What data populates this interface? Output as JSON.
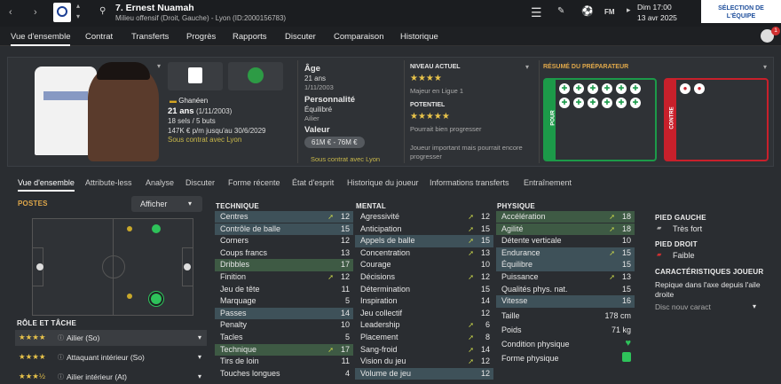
{
  "header": {
    "number_name": "7. Ernest Nuamah",
    "subtitle": "Milieu offensif (Droit, Gauche) - Lyon (ID:2000156783)",
    "day_time": "Dim 17:00",
    "date": "13 avr 2025",
    "team_select": "SÉLECTION DE L'ÉQUIPE",
    "fm_label": "FM",
    "badge_count": "1"
  },
  "nav": [
    "Vue d'ensemble",
    "Contrat",
    "Transferts",
    "Progrès",
    "Rapports",
    "Discuter",
    "Comparaison",
    "Historique"
  ],
  "profile": {
    "nationality": "Ghanéen",
    "age_line": "21 ans",
    "dob": "(1/11/2003)",
    "caps": "18 sels / 5 buts",
    "wage": "147K € p/m jusqu'au 30/6/2029",
    "contract": "Sous contrat avec Lyon"
  },
  "details": {
    "age_label": "Âge",
    "age_value": "21 ans",
    "age_date": "1/11/2003",
    "perso_label": "Personnalité",
    "perso_value": "Équilibré",
    "role_hint": "Ailier",
    "value_label": "Valeur",
    "value": "61M € - 76M €",
    "contract": "Sous contrat avec Lyon"
  },
  "level": {
    "current_label": "NIVEAU ACTUEL",
    "current_stars": "★★★★",
    "current_desc": "Majeur en Ligue 1",
    "potential_label": "POTENTIEL",
    "potential_stars": "★★★★★",
    "potential_desc": "Pourrait bien progresser",
    "summary": "Joueur important mais pourrait encore progresser"
  },
  "coach": {
    "title": "RÉSUMÉ DU PRÉPARATEUR",
    "pour": "POUR",
    "contre": "CONTRE"
  },
  "tabs": [
    "Vue d'ensemble",
    "Attribute-less",
    "Analyse",
    "Discuter",
    "Forme récente",
    "État d'esprit",
    "Historique du joueur",
    "Informations transferts",
    "Entraînement"
  ],
  "positions": {
    "title": "POSTES",
    "display_btn": "Afficher"
  },
  "roles": {
    "title": "RÔLE ET TÂCHE",
    "items": [
      {
        "stars": "★★★★",
        "name": "Ailier (So)"
      },
      {
        "stars": "★★★★",
        "name": "Attaquant intérieur (So)"
      },
      {
        "stars": "★★★½",
        "name": "Ailier intérieur (At)"
      }
    ]
  },
  "technique": {
    "title": "TECHNIQUE",
    "rows": [
      {
        "n": "Centres",
        "v": "12",
        "a": "➚"
      },
      {
        "n": "Contrôle de balle",
        "v": "15",
        "a": ""
      },
      {
        "n": "Corners",
        "v": "12",
        "a": ""
      },
      {
        "n": "Coups francs",
        "v": "13",
        "a": ""
      },
      {
        "n": "Dribbles",
        "v": "17",
        "a": ""
      },
      {
        "n": "Finition",
        "v": "12",
        "a": "➚"
      },
      {
        "n": "Jeu de tête",
        "v": "11",
        "a": ""
      },
      {
        "n": "Marquage",
        "v": "5",
        "a": ""
      },
      {
        "n": "Passes",
        "v": "14",
        "a": ""
      },
      {
        "n": "Penalty",
        "v": "10",
        "a": ""
      },
      {
        "n": "Tacles",
        "v": "5",
        "a": ""
      },
      {
        "n": "Technique",
        "v": "17",
        "a": "➚"
      },
      {
        "n": "Tirs de loin",
        "v": "11",
        "a": ""
      },
      {
        "n": "Touches longues",
        "v": "4",
        "a": ""
      }
    ]
  },
  "mental": {
    "title": "MENTAL",
    "rows": [
      {
        "n": "Agressivité",
        "v": "12",
        "a": "➚"
      },
      {
        "n": "Anticipation",
        "v": "15",
        "a": "➚"
      },
      {
        "n": "Appels de balle",
        "v": "15",
        "a": "➚"
      },
      {
        "n": "Concentration",
        "v": "13",
        "a": "➚"
      },
      {
        "n": "Courage",
        "v": "10",
        "a": ""
      },
      {
        "n": "Décisions",
        "v": "12",
        "a": "➚"
      },
      {
        "n": "Détermination",
        "v": "15",
        "a": ""
      },
      {
        "n": "Inspiration",
        "v": "14",
        "a": ""
      },
      {
        "n": "Jeu collectif",
        "v": "12",
        "a": ""
      },
      {
        "n": "Leadership",
        "v": "6",
        "a": "➚"
      },
      {
        "n": "Placement",
        "v": "8",
        "a": "➚"
      },
      {
        "n": "Sang-froid",
        "v": "14",
        "a": "➚"
      },
      {
        "n": "Vision du jeu",
        "v": "12",
        "a": "➚"
      },
      {
        "n": "Volume de jeu",
        "v": "12",
        "a": ""
      }
    ]
  },
  "physique": {
    "title": "PHYSIQUE",
    "rows": [
      {
        "n": "Accélération",
        "v": "18",
        "a": "➚"
      },
      {
        "n": "Agilité",
        "v": "18",
        "a": "➚"
      },
      {
        "n": "Détente verticale",
        "v": "10",
        "a": ""
      },
      {
        "n": "Endurance",
        "v": "15",
        "a": "➚"
      },
      {
        "n": "Équilibre",
        "v": "15",
        "a": ""
      },
      {
        "n": "Puissance",
        "v": "13",
        "a": "➚"
      },
      {
        "n": "Qualités phys. nat.",
        "v": "15",
        "a": ""
      },
      {
        "n": "Vitesse",
        "v": "16",
        "a": ""
      }
    ],
    "taille_label": "Taille",
    "taille": "178 cm",
    "poids_label": "Poids",
    "poids": "71 kg",
    "cond_label": "Condition physique",
    "forme_label": "Forme physique"
  },
  "feet": {
    "left_label": "PIED GAUCHE",
    "left": "Très fort",
    "right_label": "PIED DROIT",
    "right": "Faible",
    "traits_label": "CARACTÉRISTIQUES JOUEUR",
    "trait": "Repique dans l'axe depuis l'aile droite",
    "disc": "Disc nouv caract"
  },
  "colors": {
    "pour": "#1c9a49",
    "contre": "#c8202b",
    "highlight": "#3e5159",
    "arrow": "#c9d64a"
  }
}
